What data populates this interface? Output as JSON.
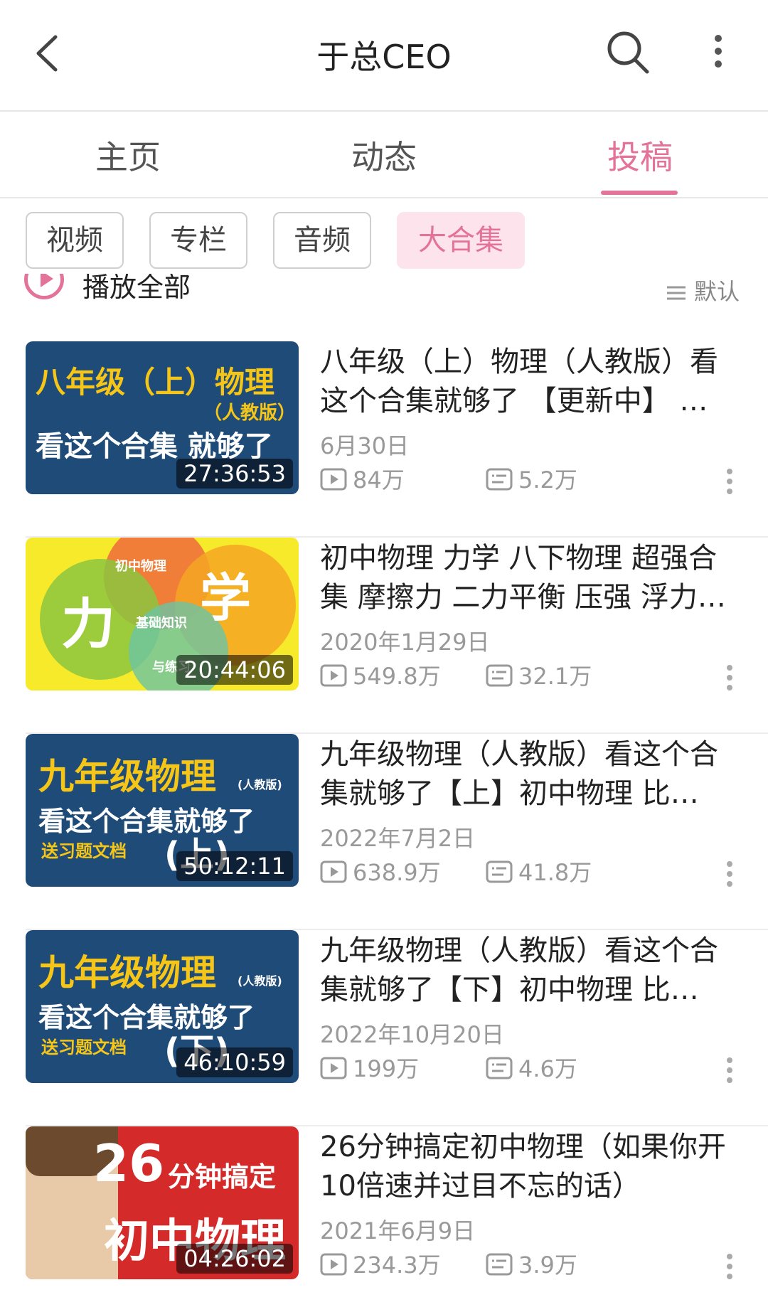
{
  "header": {
    "title": "于总CEO",
    "back_icon": "chevron-left-icon",
    "search_icon": "search-icon",
    "more_icon": "more-vertical-icon"
  },
  "tabs": [
    {
      "label": "主页",
      "active": false
    },
    {
      "label": "动态",
      "active": false
    },
    {
      "label": "投稿",
      "active": true
    }
  ],
  "filters": [
    {
      "label": "视频",
      "active": false
    },
    {
      "label": "专栏",
      "active": false
    },
    {
      "label": "音频",
      "active": false
    },
    {
      "label": "大合集",
      "active": true
    }
  ],
  "play_all": {
    "label": "播放全部",
    "sort_label": "默认"
  },
  "colors": {
    "accent": "#e4739a",
    "accent_bg": "#fde4ec"
  },
  "videos": [
    {
      "thumb_lines": [
        "八年级（上）物理",
        "（人教版）",
        "看这个合集 就够了"
      ],
      "duration": "27:36:53",
      "title": "八年级（上）物理（人教版）看这个合集就够了 【更新中】 …",
      "date": "6月30日",
      "plays": "84万",
      "danmaku": "5.2万"
    },
    {
      "thumb_lines": [
        "力",
        "学",
        "初中物理",
        "基础知识",
        "与练习"
      ],
      "duration": "20:44:06",
      "title": "初中物理 力学 八下物理 超强合集 摩擦力 二力平衡 压强 浮力…",
      "date": "2020年1月29日",
      "plays": "549.8万",
      "danmaku": "32.1万"
    },
    {
      "thumb_lines": [
        "九年级物理",
        "(人教版)",
        "看这个合集就够了",
        "送习题文档",
        "(上)"
      ],
      "duration": "50:12:11",
      "title": "九年级物理（人教版）看这个合集就够了【上】初中物理 比…",
      "date": "2022年7月2日",
      "plays": "638.9万",
      "danmaku": "41.8万"
    },
    {
      "thumb_lines": [
        "九年级物理",
        "(人教版)",
        "看这个合集就够了",
        "送习题文档",
        "(下)"
      ],
      "duration": "46:10:59",
      "title": "九年级物理（人教版）看这个合集就够了【下】初中物理 比…",
      "date": "2022年10月20日",
      "plays": "199万",
      "danmaku": "4.6万"
    },
    {
      "thumb_lines": [
        "26",
        "分钟搞定",
        "初中物理"
      ],
      "duration": "04:26:02",
      "title": "26分钟搞定初中物理（如果你开10倍速并过目不忘的话）",
      "date": "2021年6月9日",
      "plays": "234.3万",
      "danmaku": "3.9万"
    }
  ]
}
